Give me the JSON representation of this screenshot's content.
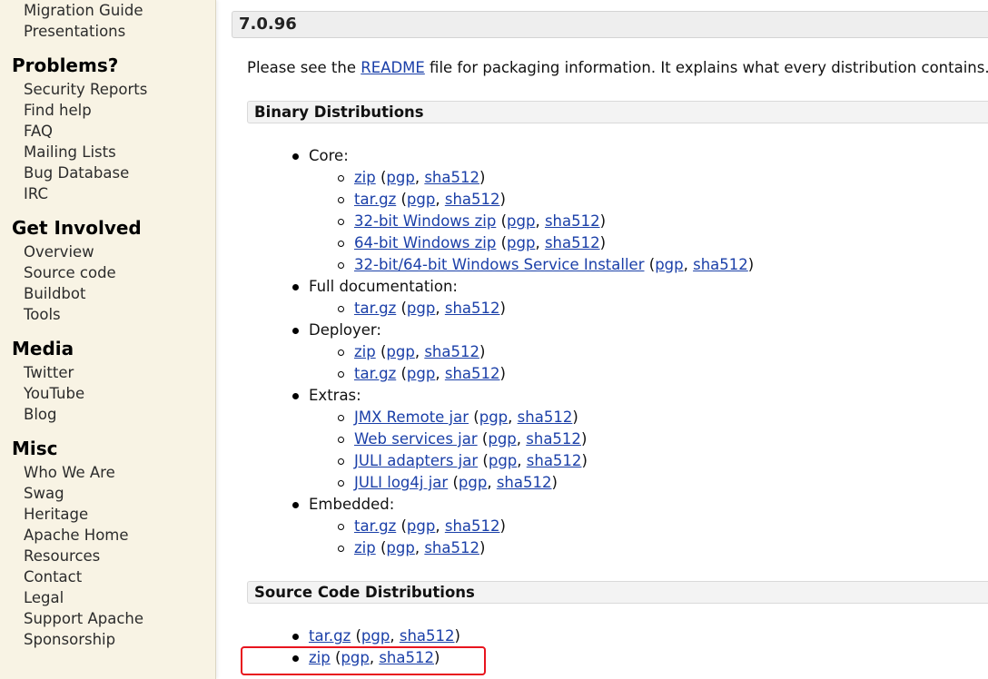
{
  "sidebar": {
    "groups": [
      {
        "heading": "",
        "items": [
          "Migration Guide",
          "Presentations"
        ]
      },
      {
        "heading": "Problems?",
        "items": [
          "Security Reports",
          "Find help",
          "FAQ",
          "Mailing Lists",
          "Bug Database",
          "IRC"
        ]
      },
      {
        "heading": "Get Involved",
        "items": [
          "Overview",
          "Source code",
          "Buildbot",
          "Tools"
        ]
      },
      {
        "heading": "Media",
        "items": [
          "Twitter",
          "YouTube",
          "Blog"
        ]
      },
      {
        "heading": "Misc",
        "items": [
          "Who We Are",
          "Swag",
          "Heritage",
          "Apache Home",
          "Resources",
          "Contact",
          "Legal",
          "Support Apache",
          "Sponsorship"
        ]
      }
    ]
  },
  "main": {
    "version": "7.0.96",
    "intro": {
      "before": "Please see the ",
      "link": "README",
      "after": " file for packaging information. It explains what every distribution contains."
    },
    "binary": {
      "title": "Binary Distributions",
      "groups": [
        {
          "label": "Core:",
          "items": [
            {
              "name": "zip",
              "sig": "pgp",
              "hash": "sha512"
            },
            {
              "name": "tar.gz",
              "sig": "pgp",
              "hash": "sha512"
            },
            {
              "name": "32-bit Windows zip",
              "sig": "pgp",
              "hash": "sha512"
            },
            {
              "name": "64-bit Windows zip",
              "sig": "pgp",
              "hash": "sha512"
            },
            {
              "name": "32-bit/64-bit Windows Service Installer",
              "sig": "pgp",
              "hash": "sha512"
            }
          ]
        },
        {
          "label": "Full documentation:",
          "items": [
            {
              "name": "tar.gz",
              "sig": "pgp",
              "hash": "sha512"
            }
          ]
        },
        {
          "label": "Deployer:",
          "items": [
            {
              "name": "zip",
              "sig": "pgp",
              "hash": "sha512"
            },
            {
              "name": "tar.gz",
              "sig": "pgp",
              "hash": "sha512"
            }
          ]
        },
        {
          "label": "Extras:",
          "items": [
            {
              "name": "JMX Remote jar",
              "sig": "pgp",
              "hash": "sha512"
            },
            {
              "name": "Web services jar",
              "sig": "pgp",
              "hash": "sha512"
            },
            {
              "name": "JULI adapters jar",
              "sig": "pgp",
              "hash": "sha512"
            },
            {
              "name": "JULI log4j jar",
              "sig": "pgp",
              "hash": "sha512"
            }
          ]
        },
        {
          "label": "Embedded:",
          "items": [
            {
              "name": "tar.gz",
              "sig": "pgp",
              "hash": "sha512"
            },
            {
              "name": "zip",
              "sig": "pgp",
              "hash": "sha512"
            }
          ]
        }
      ]
    },
    "source": {
      "title": "Source Code Distributions",
      "items": [
        {
          "name": "tar.gz",
          "sig": "pgp",
          "hash": "sha512"
        },
        {
          "name": "zip",
          "sig": "pgp",
          "hash": "sha512"
        }
      ]
    },
    "punct": {
      "open": " (",
      "sep": ", ",
      "close": ")"
    }
  },
  "colors": {
    "sidebar_bg": "#f8f3e4",
    "link": "#1a3fa8",
    "highlight": "#e8141e"
  }
}
